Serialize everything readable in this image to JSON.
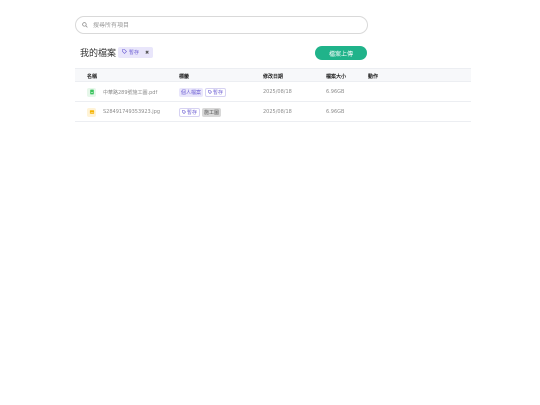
{
  "search": {
    "placeholder": "搜尋所有項目"
  },
  "header": {
    "title": "我的檔案",
    "filter_chip": {
      "label": "暫存",
      "close": "✖"
    },
    "upload_label": "檔案上傳"
  },
  "table": {
    "columns": {
      "name": "名稱",
      "tags": "標籤",
      "date": "修改日期",
      "size": "檔案大小",
      "action": "動作"
    },
    "rows": [
      {
        "name": "中華路289號施工圖.pdf",
        "icon": "pdf-file-icon",
        "tags": [
          "個人檔案",
          "暫存"
        ],
        "date": "2025/08/18",
        "size": "6.96GB"
      },
      {
        "name": "S28491749353923.jpg",
        "icon": "image-file-icon",
        "tags": [
          "暫存",
          "施工圖"
        ],
        "date": "2025/08/18",
        "size": "6.96GB"
      }
    ]
  },
  "colors": {
    "accent": "#20b38a",
    "tag_purple": "#6c5dd3",
    "tag_bg": "#e9e6fb"
  }
}
